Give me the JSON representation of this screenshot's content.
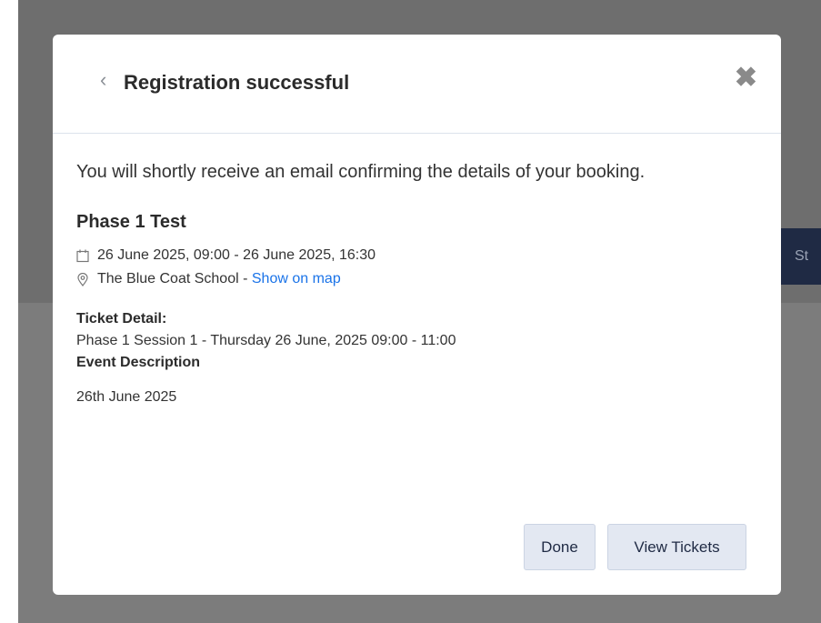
{
  "background": {
    "button_fragment": "St"
  },
  "modal": {
    "title": "Registration successful",
    "back_icon": "chevron-left-icon",
    "close_icon": "close-icon",
    "close_glyph": "✖",
    "intro_text": "You will shortly receive an email confirming the details of your booking.",
    "event_title": "Phase 1 Test",
    "date_range": "26 June 2025, 09:00 - 26 June 2025, 16:30",
    "location": "The Blue Coat School - ",
    "map_link": "Show on map",
    "ticket_detail_label": "Ticket Detail:",
    "ticket_detail": "Phase 1 Session 1 - Thursday 26 June, 2025 09:00 - 11:00",
    "event_description_label": "Event Description",
    "event_description": "26th June 2025",
    "done_label": "Done",
    "view_tickets_label": "View Tickets"
  },
  "colors": {
    "backdrop": "#6e6e6e",
    "button_bg": "#e3e8f2",
    "link": "#1a73e8",
    "bg_button": "#1f2a44"
  }
}
